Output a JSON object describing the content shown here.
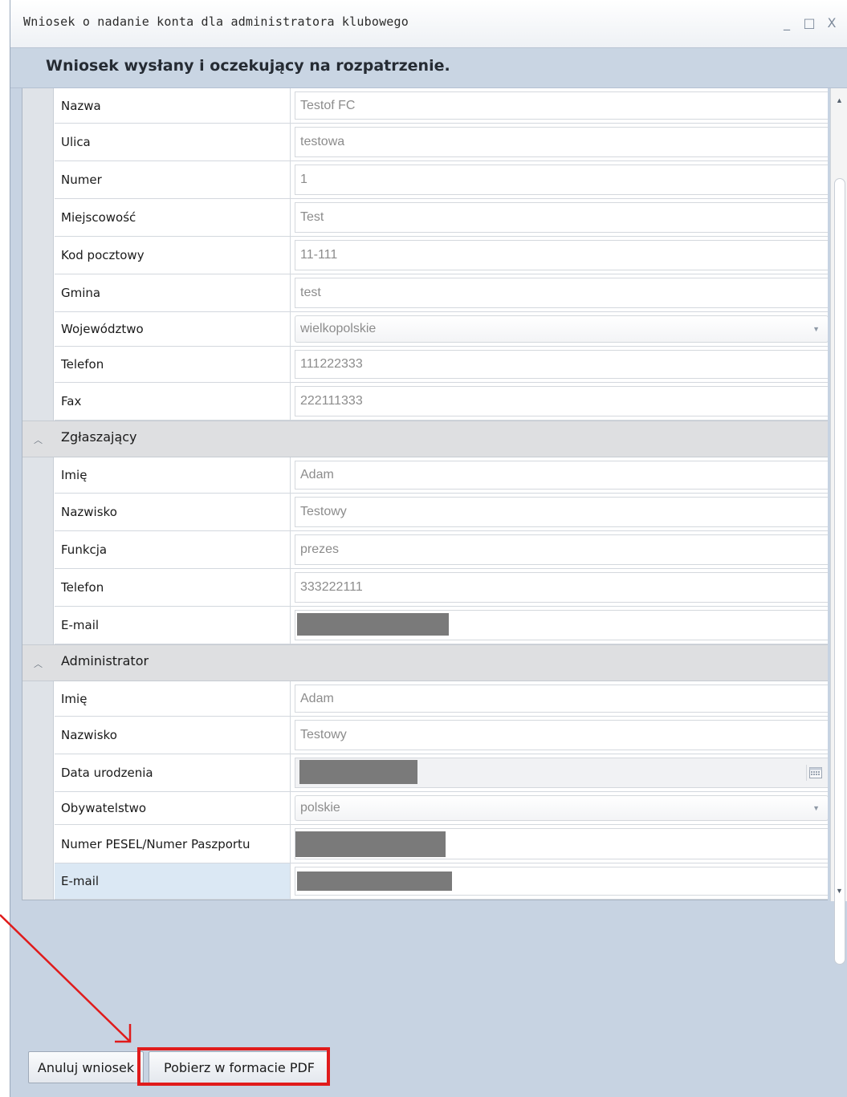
{
  "window": {
    "title": "Wniosek o nadanie konta dla administratora klubowego",
    "controls": {
      "minimize": "_",
      "maximize": "□",
      "close": "X"
    }
  },
  "status": {
    "message": "Wniosek wysłany i oczekujący na rozpatrzenie."
  },
  "club": {
    "rows": [
      {
        "label": "Nazwa",
        "value": "Testof FC"
      },
      {
        "label": "Ulica",
        "value": "testowa"
      },
      {
        "label": "Numer",
        "value": "1"
      },
      {
        "label": "Miejscowość",
        "value": "Test"
      },
      {
        "label": "Kod pocztowy",
        "value": "11-111"
      },
      {
        "label": "Gmina",
        "value": "test"
      },
      {
        "label": "Województwo",
        "value": "wielkopolskie"
      },
      {
        "label": "Telefon",
        "value": "111222333"
      },
      {
        "label": "Fax",
        "value": "222111333"
      }
    ]
  },
  "reporter": {
    "group_label": "Zgłaszający",
    "rows": [
      {
        "label": "Imię",
        "value": "Adam"
      },
      {
        "label": "Nazwisko",
        "value": "Testowy"
      },
      {
        "label": "Funkcja",
        "value": "prezes"
      },
      {
        "label": "Telefon",
        "value": "333222111"
      },
      {
        "label": "E-mail",
        "value": ""
      }
    ]
  },
  "administrator": {
    "group_label": "Administrator",
    "rows": [
      {
        "label": "Imię",
        "value": "Adam"
      },
      {
        "label": "Nazwisko",
        "value": "Testowy"
      },
      {
        "label": "Data urodzenia",
        "value": ""
      },
      {
        "label": "Obywatelstwo",
        "value": "polskie"
      },
      {
        "label": "Numer PESEL/Numer Paszportu",
        "value": ""
      },
      {
        "label": "E-mail",
        "value": ""
      }
    ]
  },
  "icons": {
    "group_collapse": "chevron-up-icon",
    "dropdown": "caret-down-icon",
    "calendar": "calendar-icon"
  },
  "footer": {
    "cancel_label": "Anuluj wniosek",
    "pdf_label": "Pobierz w formacie PDF"
  },
  "colors": {
    "annotation": "#e01b1b",
    "dialog_bg": "#c7d3e2",
    "redaction": "#7a7a7a"
  }
}
